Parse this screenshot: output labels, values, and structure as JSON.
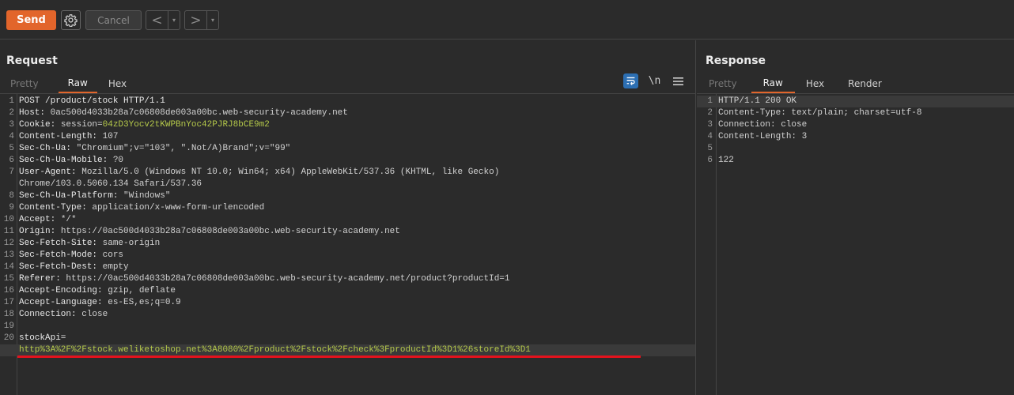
{
  "toolbar": {
    "send_label": "Send",
    "cancel_label": "Cancel",
    "back_arrow": "<",
    "forward_arrow": ">",
    "dropdown_glyph": "▾"
  },
  "colors": {
    "accent": "#e2652b",
    "background": "#2b2b2b",
    "cookie_value": "#b5c94a",
    "underline": "#e4121d",
    "wrap_button": "#2c6fb3"
  },
  "request": {
    "title": "Request",
    "tabs": [
      "Pretty",
      "Raw",
      "Hex"
    ],
    "active_tab": "Raw",
    "newline_toggle": "\\n",
    "lines": [
      {
        "n": "1",
        "key": "POST /product/stock HTTP/1.1",
        "val": ""
      },
      {
        "n": "2",
        "key": "Host: ",
        "val": "0ac500d4033b28a7c06808de003a00bc.web-security-academy.net"
      },
      {
        "n": "3",
        "key": "Cookie: ",
        "val": "session=",
        "green": "04zD3Yocv2tKWPBnYoc42PJRJ8bCE9m2"
      },
      {
        "n": "4",
        "key": "Content-Length: ",
        "val": "107"
      },
      {
        "n": "5",
        "key": "Sec-Ch-Ua: ",
        "val": "\"Chromium\";v=\"103\", \".Not/A)Brand\";v=\"99\""
      },
      {
        "n": "6",
        "key": "Sec-Ch-Ua-Mobile: ",
        "val": "?0"
      },
      {
        "n": "7",
        "key": "User-Agent: ",
        "val": "Mozilla/5.0 (Windows NT 10.0; Win64; x64) AppleWebKit/537.36 (KHTML, like Gecko)"
      },
      {
        "n": "",
        "key": "",
        "val": "Chrome/103.0.5060.134 Safari/537.36"
      },
      {
        "n": "8",
        "key": "Sec-Ch-Ua-Platform: ",
        "val": "\"Windows\""
      },
      {
        "n": "9",
        "key": "Content-Type: ",
        "val": "application/x-www-form-urlencoded"
      },
      {
        "n": "10",
        "key": "Accept: ",
        "val": "*/*"
      },
      {
        "n": "11",
        "key": "Origin: ",
        "val": "https://0ac500d4033b28a7c06808de003a00bc.web-security-academy.net"
      },
      {
        "n": "12",
        "key": "Sec-Fetch-Site: ",
        "val": "same-origin"
      },
      {
        "n": "13",
        "key": "Sec-Fetch-Mode: ",
        "val": "cors"
      },
      {
        "n": "14",
        "key": "Sec-Fetch-Dest: ",
        "val": "empty"
      },
      {
        "n": "15",
        "key": "Referer: ",
        "val": "https://0ac500d4033b28a7c06808de003a00bc.web-security-academy.net/product?productId=1"
      },
      {
        "n": "16",
        "key": "Accept-Encoding: ",
        "val": "gzip, deflate"
      },
      {
        "n": "17",
        "key": "Accept-Language: ",
        "val": "es-ES,es;q=0.9"
      },
      {
        "n": "18",
        "key": "Connection: ",
        "val": "close"
      },
      {
        "n": "19",
        "key": "",
        "val": ""
      },
      {
        "n": "20",
        "key": "stockApi=",
        "val": ""
      },
      {
        "n": "",
        "key": "",
        "val": "",
        "green": "http%3A%2F%2Fstock.weliketoshop.net%3A8080%2Fproduct%2Fstock%2Fcheck%3FproductId%3D1%26storeId%3D1"
      }
    ]
  },
  "response": {
    "title": "Response",
    "tabs": [
      "Pretty",
      "Raw",
      "Hex",
      "Render"
    ],
    "active_tab": "Raw",
    "lines": [
      {
        "n": "1",
        "text": "HTTP/1.1 200 OK"
      },
      {
        "n": "2",
        "text": "Content-Type: text/plain; charset=utf-8"
      },
      {
        "n": "3",
        "text": "Connection: close"
      },
      {
        "n": "4",
        "text": "Content-Length: 3"
      },
      {
        "n": "5",
        "text": ""
      },
      {
        "n": "6",
        "text": "122"
      }
    ]
  }
}
